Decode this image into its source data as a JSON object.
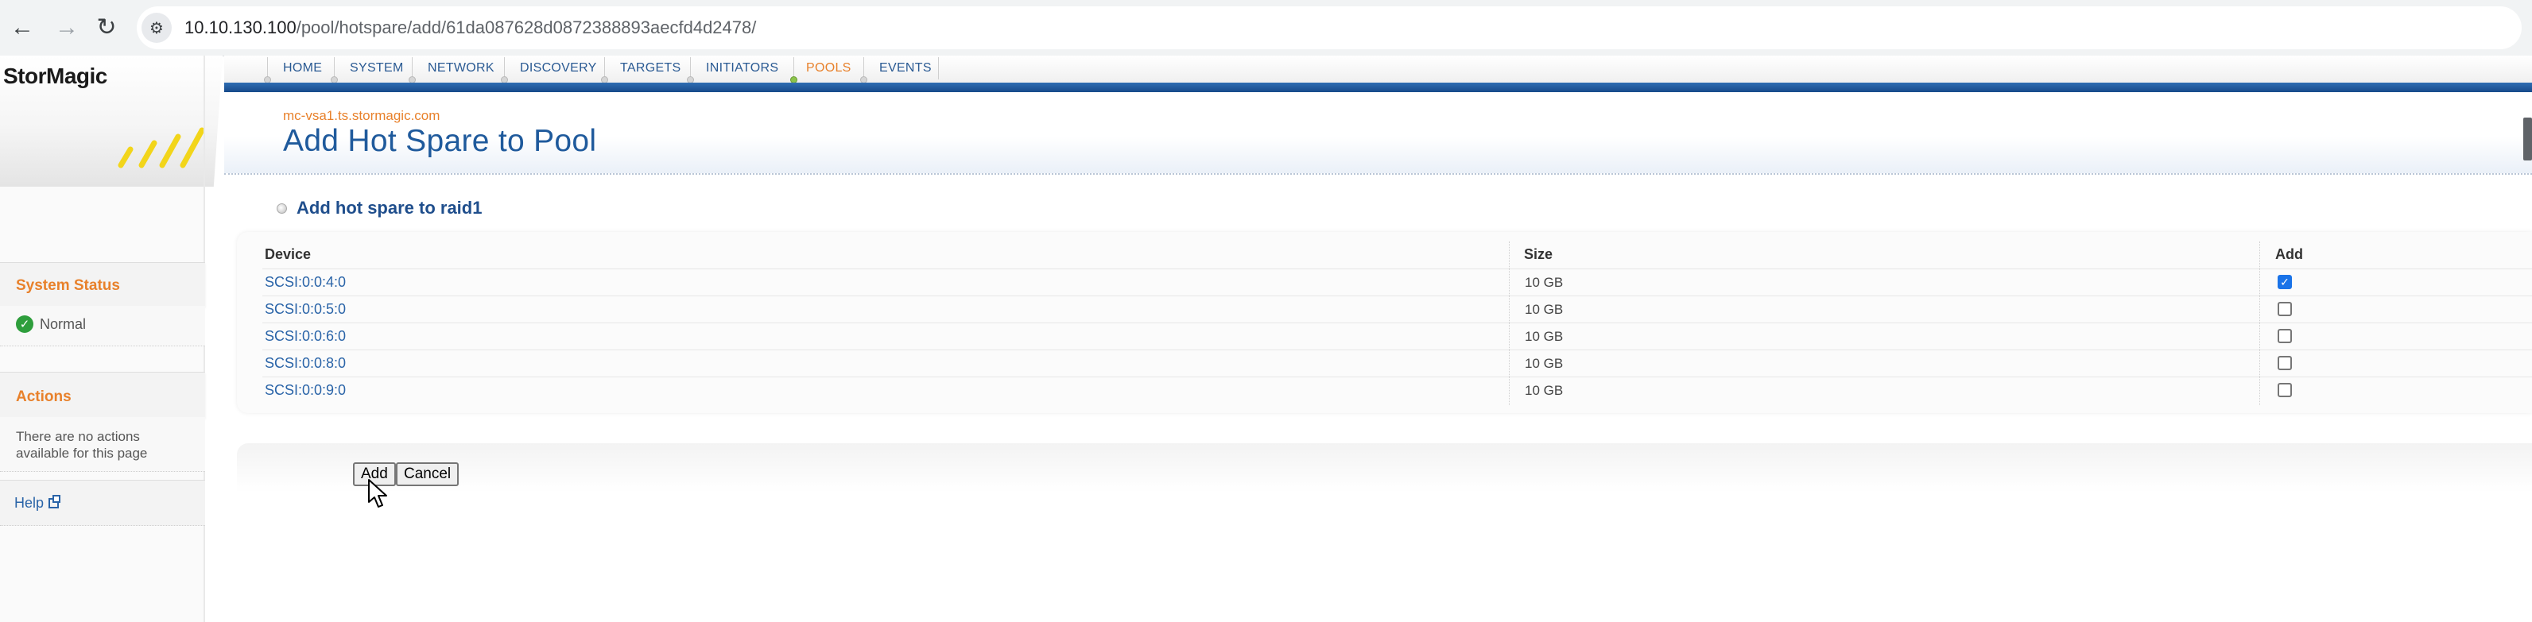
{
  "browser": {
    "url_host": "10.10.130.100",
    "url_path": "/pool/hotspare/add/61da087628d0872388893aecfd4d2478/",
    "back_glyph": "←",
    "forward_glyph": "→",
    "reload_glyph": "↻",
    "site_info_glyph": "⚙"
  },
  "logo": {
    "text": "StorMagic"
  },
  "nav": {
    "tabs": [
      {
        "label": "HOME"
      },
      {
        "label": "SYSTEM"
      },
      {
        "label": "NETWORK"
      },
      {
        "label": "DISCOVERY"
      },
      {
        "label": "TARGETS"
      },
      {
        "label": "INITIATORS"
      },
      {
        "label": "POOLS"
      },
      {
        "label": "EVENTS"
      }
    ],
    "active": "POOLS"
  },
  "header": {
    "host": "mc-vsa1.ts.stormagic.com",
    "title": "Add Hot Spare to Pool"
  },
  "sidebar": {
    "system_status": {
      "title": "System Status",
      "value": "Normal",
      "ok_glyph": "✓"
    },
    "actions": {
      "title": "Actions",
      "text": "There are no actions available for this page"
    },
    "help": {
      "label": "Help"
    }
  },
  "panel": {
    "title": "Add hot spare to raid1",
    "columns": {
      "device": "Device",
      "size": "Size",
      "add": "Add"
    },
    "rows": [
      {
        "device": "SCSI:0:0:4:0",
        "size": "10 GB",
        "add": true
      },
      {
        "device": "SCSI:0:0:5:0",
        "size": "10 GB",
        "add": false
      },
      {
        "device": "SCSI:0:0:6:0",
        "size": "10 GB",
        "add": false
      },
      {
        "device": "SCSI:0:0:8:0",
        "size": "10 GB",
        "add": false
      },
      {
        "device": "SCSI:0:0:9:0",
        "size": "10 GB",
        "add": false
      }
    ],
    "check_glyph": "✓"
  },
  "buttons": {
    "add": "Add",
    "cancel": "Cancel"
  },
  "colors": {
    "accent_orange": "#e8812b",
    "link_blue": "#2a64a8",
    "nav_blue": "#1f5a9c",
    "status_green": "#2e9e3c"
  }
}
